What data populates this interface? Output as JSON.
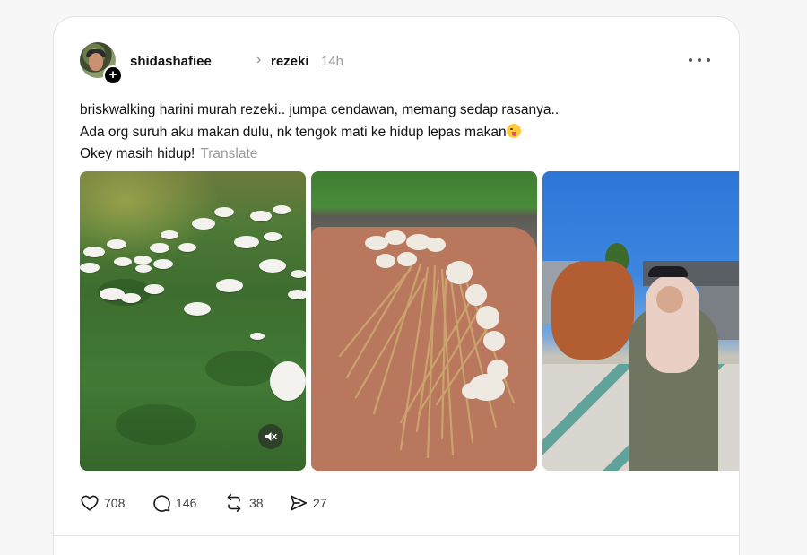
{
  "post": {
    "username": "shidashafiee",
    "topic": "rezeki",
    "time": "14h",
    "caption_lines": [
      "briskwalking harini murah rezeki.. jumpa cendawan, memang sedap rasanya..",
      "Ada org suruh aku makan dulu, nk tengok mati ke hidup lepas makan",
      "Okey masih hidup!"
    ],
    "translate_label": "Translate",
    "media": [
      {
        "name": "mushrooms-on-grass-video",
        "icon": "muted-speaker-icon"
      },
      {
        "name": "mushrooms-on-cloth-photo"
      },
      {
        "name": "woman-holding-bag-photo"
      }
    ],
    "actions": {
      "likes": "708",
      "comments": "146",
      "reposts": "38",
      "shares": "27"
    }
  },
  "colors": {
    "background": "#f7f7f7",
    "card": "#ffffff",
    "text": "#101010",
    "muted": "#999999"
  }
}
